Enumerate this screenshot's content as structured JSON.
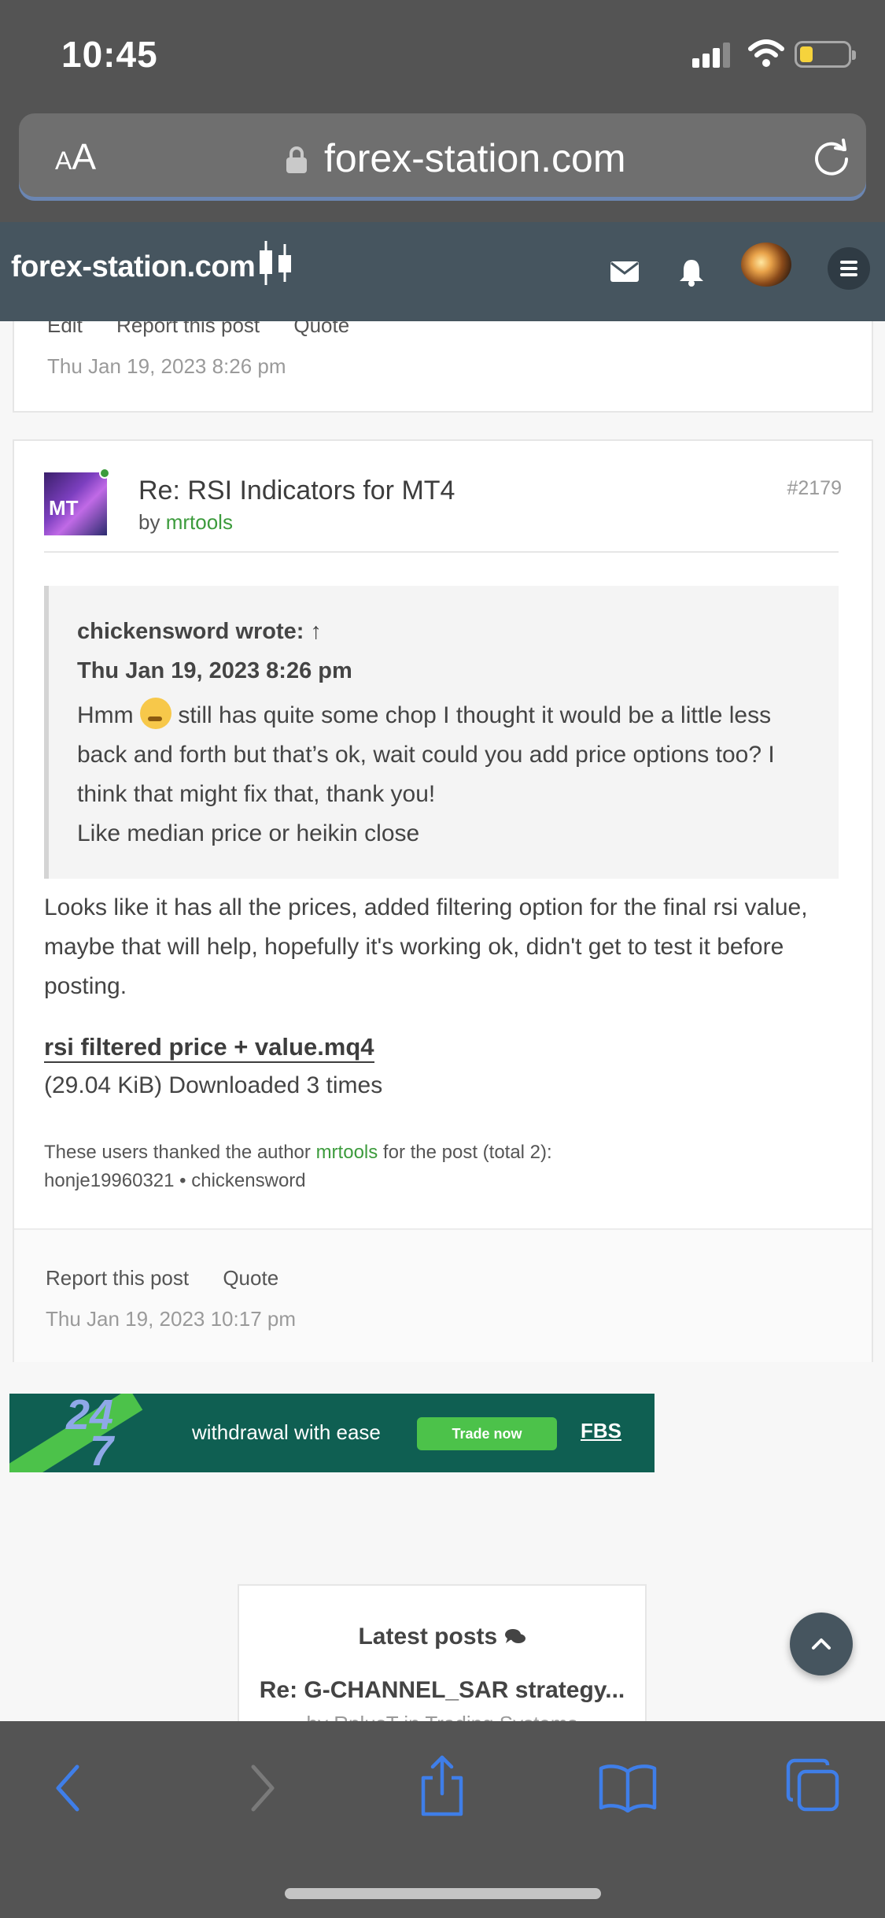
{
  "status_bar": {
    "time": "10:45"
  },
  "browser": {
    "reader_label_small": "A",
    "reader_label_large": "A",
    "url": "forex-station.com"
  },
  "site_header": {
    "logo_text": "forex-station.com"
  },
  "previous_post": {
    "actions": [
      "Edit",
      "Report this post",
      "Quote"
    ],
    "date": "Thu Jan 19, 2023 8:26 pm"
  },
  "post": {
    "title": "Re: RSI Indicators for MT4",
    "number": "#2179",
    "by_label": "by",
    "author": "mrtools",
    "avatar_text": "MT",
    "quote": {
      "author_line": "chickensword wrote: ↑",
      "date": "Thu Jan 19, 2023 8:26 pm",
      "text_before_emoji": "Hmm",
      "text_after_emoji": "still has quite some chop I thought it would be a little less back and forth but that’s ok, wait could you add price options too? I think that might fix that, thank you!",
      "second_line": "Like median price or heikin close"
    },
    "body": "Looks like it has all the prices, added filtering option for the final rsi value, maybe that will help, hopefully it's working ok, didn't get to test it before posting.",
    "attachment": {
      "name": "rsi filtered price + value.mq4",
      "info": "(29.04 KiB) Downloaded 3 times"
    },
    "thanks": {
      "prefix": "These users thanked the author",
      "author": "mrtools",
      "suffix": "for the post (total 2):",
      "users": "honje19960321 • chickensword"
    },
    "footer_actions": [
      "Report this post",
      "Quote"
    ],
    "footer_date": "Thu Jan 19, 2023 10:17 pm"
  },
  "ad": {
    "badge_top": "24",
    "badge_bottom": "7",
    "tagline": "withdrawal with ease",
    "button": "Trade now",
    "brand": "FBS"
  },
  "latest_posts": {
    "title": "Latest posts",
    "item": "Re: G-CHANNEL_SAR strategy...",
    "sub": "by RplusT in Trading Systems"
  },
  "colors": {
    "header_bg": "#46555f",
    "link_green": "#3c9b3c",
    "chrome_bg": "#545454",
    "ios_blue": "#3f7ee8"
  }
}
